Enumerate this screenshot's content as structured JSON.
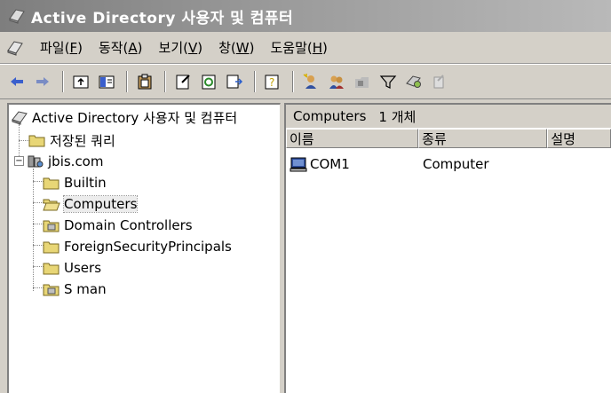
{
  "window": {
    "title": "Active Directory 사용자 및 컴퓨터"
  },
  "menu": {
    "items": [
      {
        "label": "파일(",
        "key": "F",
        "suffix": ")"
      },
      {
        "label": "동작(",
        "key": "A",
        "suffix": ")"
      },
      {
        "label": "보기(",
        "key": "V",
        "suffix": ")"
      },
      {
        "label": "창(",
        "key": "W",
        "suffix": ")"
      },
      {
        "label": "도움말(",
        "key": "H",
        "suffix": ")"
      }
    ]
  },
  "toolbar": {
    "icons": [
      "back-icon",
      "forward-icon",
      "up-folder-icon",
      "show-console-tree-icon",
      "clipboard-icon",
      "properties-icon",
      "refresh-icon",
      "export-list-icon",
      "help-icon",
      "new-user-icon",
      "new-group-icon",
      "new-ou-icon",
      "filter-icon",
      "find-icon",
      "delegate-icon"
    ]
  },
  "tree": {
    "root": "Active Directory 사용자 및 컴퓨터",
    "saved_queries": "저장된 쿼리",
    "domain": "jbis.com",
    "children": [
      "Builtin",
      "Computers",
      "Domain Controllers",
      "ForeignSecurityPrincipals",
      "Users",
      "S man"
    ],
    "selected": "Computers"
  },
  "list": {
    "header_title": "Computers",
    "header_count": "1 개체",
    "columns": [
      "이름",
      "종류",
      "설명"
    ],
    "rows": [
      {
        "name": "COM1",
        "type": "Computer",
        "description": ""
      }
    ]
  },
  "colors": {
    "title_bar": "#8c8c8c",
    "chrome": "#d4d0c8",
    "folder": "#e8d676"
  }
}
